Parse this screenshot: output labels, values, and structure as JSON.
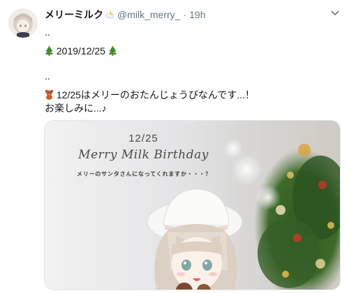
{
  "tweet": {
    "display_name": "メリーミルク",
    "display_name_emoji": "cloud-moon-icon",
    "handle": "@milk_merry_",
    "separator": "·",
    "time": "19h",
    "lines": [
      "..",
      "2019/12/25",
      "..",
      "12/25はメリーのおたんじょうびなんです...！",
      "お楽しみに...♪"
    ],
    "line_icons": {
      "date_line": "christmas-tree-icon",
      "announce_line": "teddy-bear-icon"
    }
  },
  "media": {
    "date_text": "12/25",
    "title_text": "Merry Milk Birthday",
    "subtitle_text": "メリーのサンタさんになってくれますか・・・？"
  },
  "colors": {
    "name": "#14171a",
    "secondary": "#657786",
    "border": "#e1e8ed",
    "tree_green": "#3c8a2e"
  }
}
